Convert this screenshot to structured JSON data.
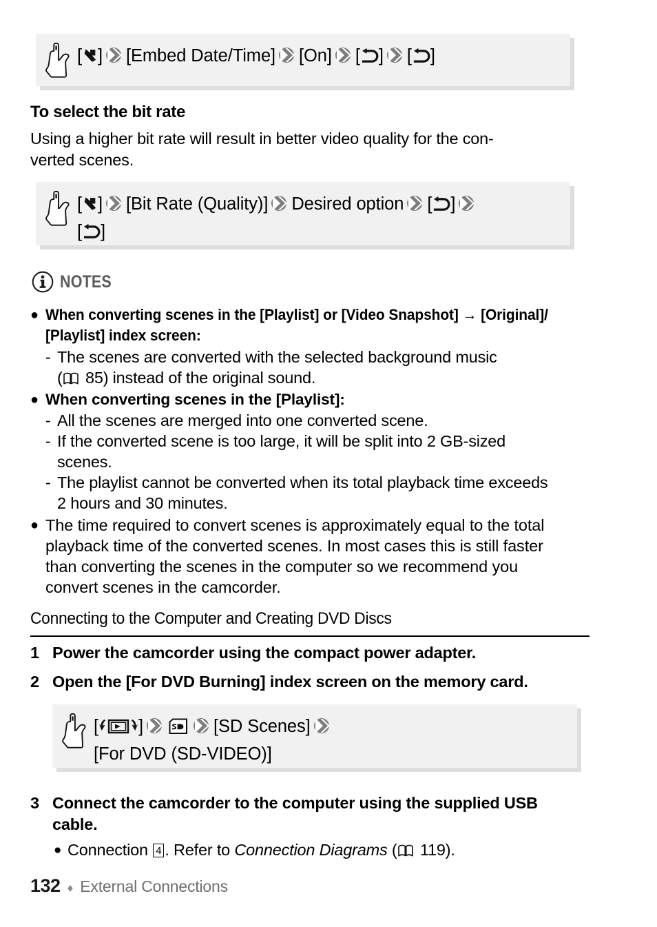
{
  "page": {
    "number": "132",
    "footer_separator": "♦",
    "footer_label": "External Connections"
  },
  "procedures": [
    {
      "id": "embed-date-time",
      "hand_icon": "pointing-hand-icon",
      "parts": [
        {
          "type": "icon",
          "icon": "wrench-icon",
          "text": "[⚒]"
        },
        {
          "type": "icon",
          "icon": "double-chevron-right-icon",
          "text": "»"
        },
        {
          "type": "text",
          "text": "[Embed Date/Time]"
        },
        {
          "type": "icon",
          "icon": "double-chevron-right-icon",
          "text": "»"
        },
        {
          "type": "text",
          "text": "[On]"
        },
        {
          "type": "icon",
          "icon": "double-chevron-right-icon",
          "text": "»"
        },
        {
          "type": "icon",
          "icon": "return-arrow-icon",
          "text": "[↩]"
        },
        {
          "type": "icon",
          "icon": "double-chevron-right-icon",
          "text": "»"
        },
        {
          "type": "icon",
          "icon": "return-arrow-icon",
          "text": "[↩]"
        }
      ]
    },
    {
      "id": "bit-rate-quality",
      "hand_icon": "pointing-hand-icon",
      "parts": [
        {
          "type": "icon",
          "icon": "wrench-icon",
          "text": "[⚒]"
        },
        {
          "type": "icon",
          "icon": "double-chevron-right-icon",
          "text": "»"
        },
        {
          "type": "text",
          "text": "[Bit Rate (Quality)]"
        },
        {
          "type": "icon",
          "icon": "double-chevron-right-icon",
          "text": "»"
        },
        {
          "type": "text",
          "text": "Desired option"
        },
        {
          "type": "icon",
          "icon": "double-chevron-right-icon",
          "text": "»"
        },
        {
          "type": "icon",
          "icon": "return-arrow-icon",
          "text": "[↩]"
        },
        {
          "type": "icon",
          "icon": "double-chevron-right-icon",
          "text": "»"
        },
        {
          "type": "icon",
          "icon": "return-arrow-icon",
          "text": "[↩]"
        }
      ]
    },
    {
      "id": "for-dvd-burning",
      "hand_icon": "pointing-hand-icon",
      "parts": [
        {
          "type": "icon",
          "icon": "playback-mode-icon",
          "text": "[▶]"
        },
        {
          "type": "icon",
          "icon": "double-chevron-right-icon",
          "text": "»"
        },
        {
          "type": "icon",
          "icon": "sd-card-icon",
          "text": "SD"
        },
        {
          "type": "icon",
          "icon": "double-chevron-right-icon",
          "text": "»"
        },
        {
          "type": "text",
          "text": "[SD Scenes]"
        },
        {
          "type": "icon",
          "icon": "double-chevron-right-icon",
          "text": "»"
        },
        {
          "type": "text",
          "text": "[For DVD (SD-VIDEO)]"
        }
      ]
    }
  ],
  "bit_rate_section": {
    "heading": "To select the bit rate",
    "paragraph_line1": "Using a higher bit rate will result in better video quality for the con-",
    "paragraph_line2": "verted scenes."
  },
  "notes": {
    "icon": "info-circle-icon",
    "label": "NOTES",
    "items": [
      {
        "bold": true,
        "line1": "When converting scenes in the [Playlist] or [Video Snapshot] → [Original]/",
        "line2": "[Playlist] index screen:",
        "subs": [
          {
            "line1": "The scenes are converted with the selected background music",
            "line2_pre": "(",
            "line2_icon": "book-icon",
            "line2_post": " 85) instead of the original sound."
          }
        ]
      },
      {
        "bold": true,
        "line1": " When converting scenes in the [Playlist]:",
        "subs": [
          {
            "line1": "All the scenes are merged into one converted scene."
          },
          {
            "line1": "If the converted scene is too large, it will be split into 2 GB-sized",
            "line2": "scenes."
          },
          {
            "line1": "The playlist cannot be converted when its total playback time exceeds",
            "line2": "2 hours and 30 minutes."
          }
        ]
      },
      {
        "bold": false,
        "line1": "The time required to convert scenes is approximately equal to the total",
        "line2": "playback time of the converted scenes. In most cases this is still faster",
        "line3": "than converting the scenes in the computer so we recommend you",
        "line4": "convert scenes in the camcorder."
      }
    ]
  },
  "dvd_section": {
    "heading": "Connecting to the Computer and Creating DVD Discs",
    "steps": [
      {
        "number": "1",
        "text": "Power the camcorder using the compact power adapter."
      },
      {
        "number": "2",
        "text": "Open the [For DVD Burning] index screen on the memory card."
      },
      {
        "number": "3",
        "text_line1": "Connect the camcorder to the computer using the supplied USB",
        "text_line2": "cable.",
        "sub_bullet": {
          "pre": "Connection ",
          "boxed_number": "4",
          "mid": ". Refer to ",
          "italic": "Connection Diagrams",
          "page_open": " (",
          "page_icon": "book-icon",
          "page_number": " 119)."
        }
      }
    ]
  },
  "colors": {
    "box_bg": "#f1f1f1",
    "box_shadow": "#d0d0d0",
    "notes_label": "#5b5b5b",
    "footer_text": "#6e6e6e",
    "arrow_gray": "#7b7b7b"
  }
}
